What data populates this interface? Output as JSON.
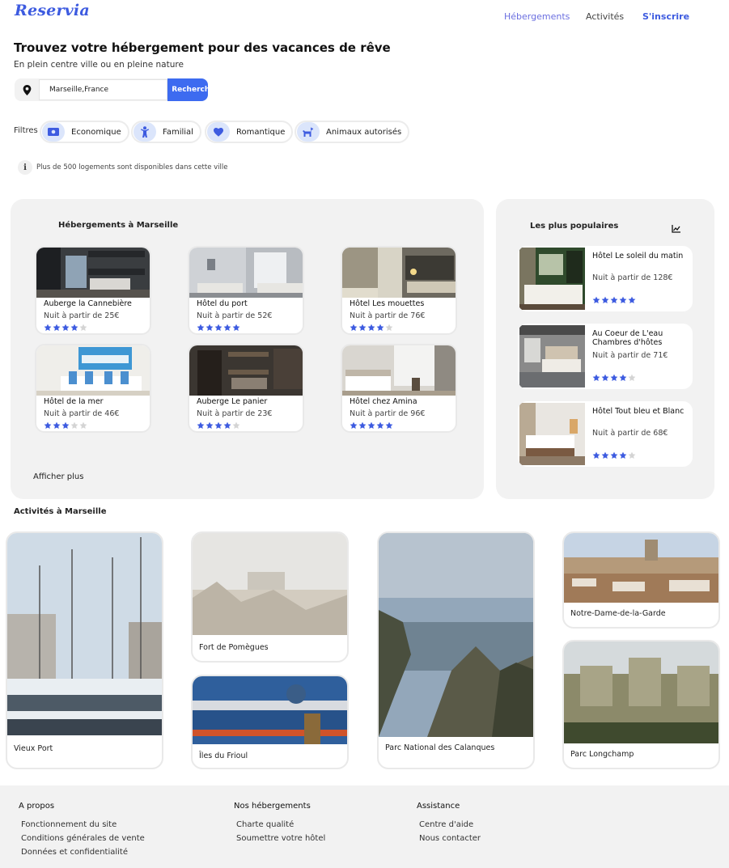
{
  "brand": {
    "logo": "Reservia",
    "accent": "#3d5be0",
    "button_color": "#3d6bf0"
  },
  "nav": {
    "hebergements": "Hébergements",
    "activites": "Activités",
    "inscrire": "S'inscrire"
  },
  "hero": {
    "title": "Trouvez votre hébergement pour des vacances de rêve",
    "subtitle": "En plein centre ville ou en pleine nature"
  },
  "search": {
    "value": "Marseille,France",
    "button": "Rechercher",
    "icon": "location-pin-icon"
  },
  "filters": {
    "label": "Filtres",
    "items": [
      {
        "label": "Economique",
        "icon": "money-icon"
      },
      {
        "label": "Familial",
        "icon": "child-icon"
      },
      {
        "label": "Romantique",
        "icon": "heart-icon"
      },
      {
        "label": "Animaux autorisés",
        "icon": "dog-icon"
      }
    ]
  },
  "info": {
    "icon": "info-icon",
    "text": "Plus de 500 logements sont disponibles dans cette ville"
  },
  "hebergements": {
    "title": "Hébergements à Marseille",
    "more": "Afficher plus",
    "items": [
      {
        "name": "Auberge la Cannebière",
        "price": "Nuit à partir de 25€",
        "rating": 4
      },
      {
        "name": "Hôtel du port",
        "price": "Nuit à partir de 52€",
        "rating": 5
      },
      {
        "name": "Hôtel Les mouettes",
        "price": "Nuit à partir de 76€",
        "rating": 4
      },
      {
        "name": "Hôtel de la mer",
        "price": "Nuit à partir de 46€",
        "rating": 3
      },
      {
        "name": "Auberge Le panier",
        "price": "Nuit à partir de 23€",
        "rating": 4
      },
      {
        "name": "Hôtel chez Amina",
        "price": "Nuit à partir de 96€",
        "rating": 5
      }
    ]
  },
  "populaires": {
    "title": "Les plus populaires",
    "icon": "trend-chart-icon",
    "items": [
      {
        "name": "Hôtel Le soleil du matin",
        "price": "Nuit à partir de 128€",
        "rating": 5
      },
      {
        "name": "Au Coeur de L'eau Chambres d'hôtes",
        "price": "Nuit à partir de 71€",
        "rating": 4
      },
      {
        "name": "Hôtel Tout bleu et Blanc",
        "price": "Nuit à partir de 68€",
        "rating": 4
      }
    ]
  },
  "activites": {
    "title": "Activités à Marseille",
    "items": [
      {
        "name": "Vieux Port"
      },
      {
        "name": "Fort de Pomègues"
      },
      {
        "name": "Îles du Frioul"
      },
      {
        "name": "Parc National des Calanques"
      },
      {
        "name": "Notre-Dame-de-la-Garde"
      },
      {
        "name": "Parc Longchamp"
      }
    ]
  },
  "footer": {
    "about": {
      "title": "A propos",
      "links": [
        "Fonctionnement du site",
        "Conditions générales de vente",
        "Données et confidentialité"
      ]
    },
    "hebergements": {
      "title": "Nos hébergements",
      "links": [
        "Charte qualité",
        "Soumettre votre hôtel"
      ]
    },
    "assistance": {
      "title": "Assistance",
      "links": [
        "Centre d'aide",
        "Nous contacter"
      ]
    }
  }
}
